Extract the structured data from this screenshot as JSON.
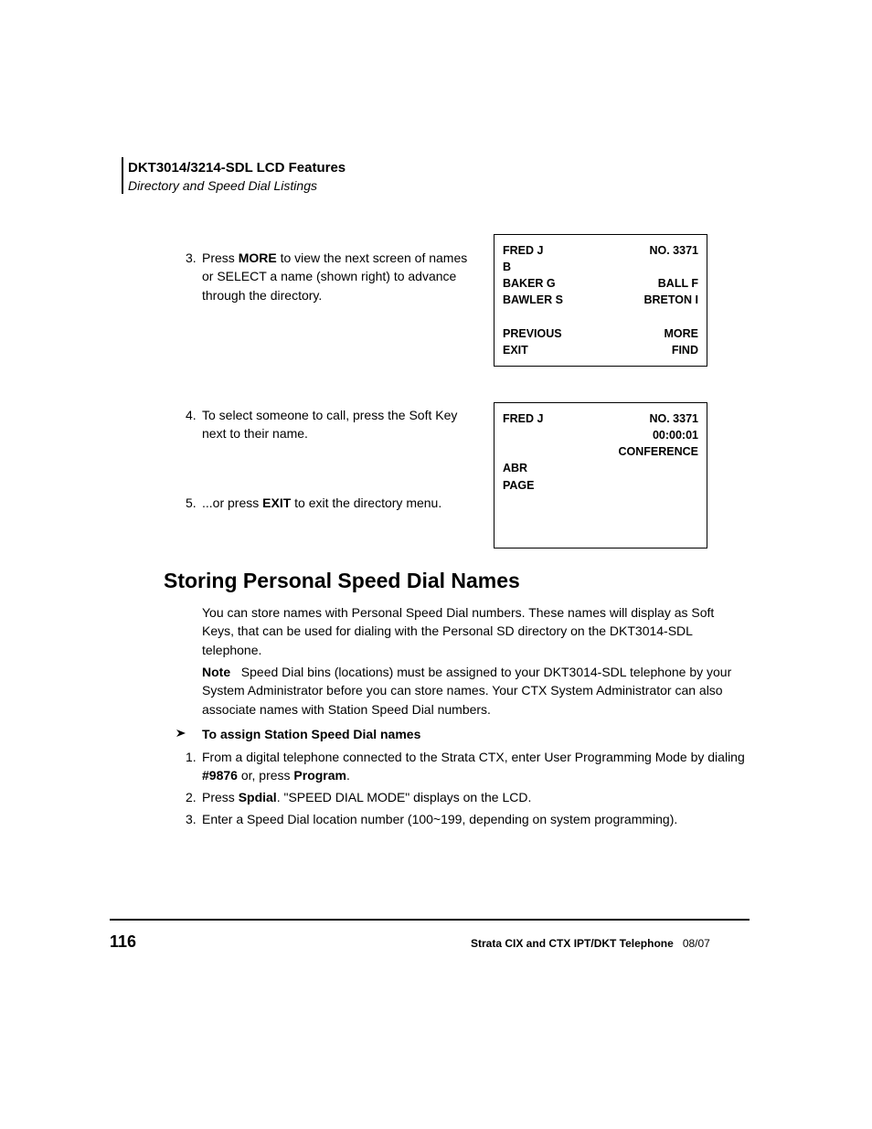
{
  "header": {
    "title": "DKT3014/3214-SDL LCD Features",
    "sub": "Directory and Speed Dial Listings"
  },
  "step3": {
    "num": "3.",
    "text_a": "Press ",
    "more": "MORE",
    "text_b": " to view the next screen of names or SELECT a name (shown right) to advance through the directory."
  },
  "lcd1": {
    "r1l": "FRED J",
    "r1r": "NO. 3371",
    "r2l": "B",
    "r3l": "BAKER G",
    "r3r": "BALL F",
    "r4l": "BAWLER S",
    "r4r": "BRETON I",
    "r5l": "PREVIOUS",
    "r5r": "MORE",
    "r6l": "EXIT",
    "r6r": "FIND"
  },
  "step4": {
    "num": "4.",
    "text": "To select someone to call, press the Soft Key next to their name."
  },
  "step5": {
    "num": "5.",
    "exit": "EXIT",
    "text_a": "Press ",
    "text_b": " to exit the directory menu."
  },
  "lcd2": {
    "r1l": "FRED J",
    "r1r": "NO. 3371",
    "r2r": "00:00:01",
    "r3r": "CONFERENCE",
    "r4l": "ABR",
    "r5l": "PAGE"
  },
  "h2": "Storing Personal Speed Dial Names",
  "intro": "You can store names with Personal Speed Dial numbers. These names will display as Soft Keys, that can be used for dialing with the Personal SD directory on the DKT3014-SDL telephone.",
  "note": {
    "label": "Note",
    "text": "Speed Dial bins (locations) must be assigned to your DKT3014-SDL telephone by your System Administrator before you can store names. Your CTX System Administrator can also associate names with Station Speed Dial numbers."
  },
  "subhead": "To assign Station Speed Dial names",
  "sd1": {
    "num": "1.",
    "text": "From a digital telephone connected to the Strata CTX, enter User Programming Mode by dialing #9876 or, press Program."
  },
  "sd2": {
    "num": "2.",
    "text": "Press Spdial. \"SPEED DIAL MODE\" displays on the LCD."
  },
  "sd3": {
    "num": "3.",
    "text": "Enter a Speed Dial location number (100~199, depending on system programming)."
  },
  "footer": {
    "page": "116",
    "right1": "Strata CIX and CTX IPT/DKT Telephone",
    "right2": "08/07"
  }
}
